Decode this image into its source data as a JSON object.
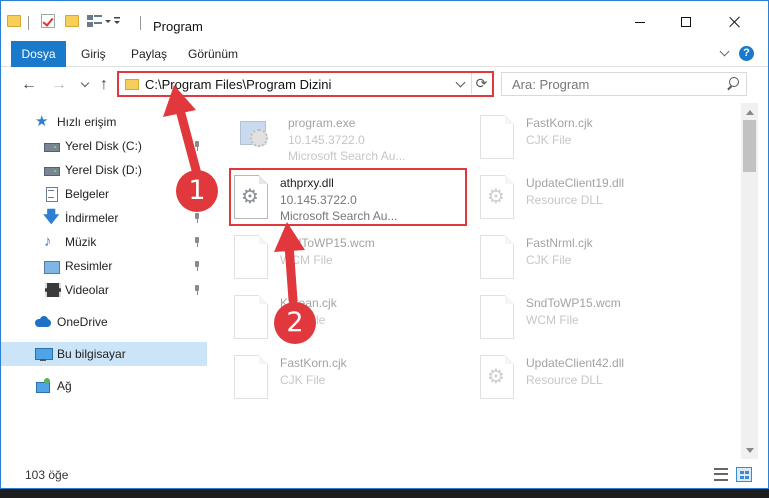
{
  "window": {
    "title": "Program",
    "controls": [
      "minimize",
      "maximize",
      "close"
    ]
  },
  "ribbon": {
    "tabs": [
      {
        "label": "Dosya",
        "active": true
      },
      {
        "label": "Giriş"
      },
      {
        "label": "Paylaş"
      },
      {
        "label": "Görünüm"
      }
    ],
    "help": "?"
  },
  "address": {
    "path": "C:\\Program Files\\Program Dizini",
    "refresh_icon": "⟳"
  },
  "search": {
    "placeholder": "Ara: Program"
  },
  "nav": {
    "back": "←",
    "forward": "→",
    "up": "↑"
  },
  "sidebar": {
    "items": [
      {
        "label": "Hızlı erişim",
        "icon": "star-icon",
        "glyph": "★"
      },
      {
        "label": "Yerel Disk (C:)",
        "icon": "drive-icon",
        "pinned": true
      },
      {
        "label": "Yerel Disk (D:)",
        "icon": "drive-icon",
        "pinned": true
      },
      {
        "label": "Belgeler",
        "icon": "documents-icon",
        "pinned": true
      },
      {
        "label": "İndirmeler",
        "icon": "download-icon",
        "glyph": "🡇",
        "pinned": true
      },
      {
        "label": "Müzik",
        "icon": "music-icon",
        "glyph": "♪",
        "pinned": true
      },
      {
        "label": "Resimler",
        "icon": "pictures-icon",
        "pinned": true
      },
      {
        "label": "Videolar",
        "icon": "video-icon",
        "pinned": true
      },
      {
        "label": "OneDrive",
        "icon": "cloud-icon"
      },
      {
        "label": "Bu bilgisayar",
        "icon": "computer-icon",
        "selected": true
      },
      {
        "label": "Ağ",
        "icon": "network-icon"
      }
    ]
  },
  "files": {
    "left": [
      {
        "name": "program.exe",
        "line1": "10.145.3722.0",
        "line2": "Microsoft Search Au..."
      },
      {
        "name": "athprxy.dll",
        "line1": "10.145.3722.0",
        "line2": "Microsoft Search Au..."
      },
      {
        "name": "SndToWP15.wcm",
        "line1": "WCM File",
        "line2": ""
      },
      {
        "name": "Korean.cjk",
        "line1": "CJK File",
        "line2": ""
      },
      {
        "name": "FastKorn.cjk",
        "line1": "CJK File",
        "line2": ""
      }
    ],
    "right": [
      {
        "name": "FastKorn.cjk",
        "line1": "CJK File"
      },
      {
        "name": "UpdateClient19.dll",
        "line1": "Resource DLL"
      },
      {
        "name": "FastNrml.cjk",
        "line1": "CJK File"
      },
      {
        "name": "SndToWP15.wcm",
        "line1": "WCM File"
      },
      {
        "name": "UpdateClient42.dll",
        "line1": "Resource DLL"
      }
    ]
  },
  "status": {
    "count": "103 öğe"
  },
  "annotations": {
    "badge1": "1",
    "badge2": "2",
    "color": "#e0383c"
  },
  "colors": {
    "accent": "#1979ca",
    "selection": "#cce4f7",
    "annotation_red": "#e0383c"
  }
}
